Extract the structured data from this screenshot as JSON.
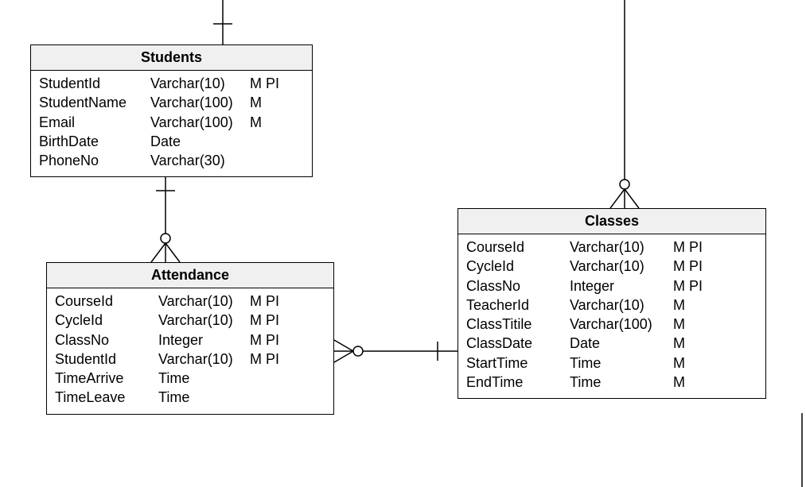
{
  "entities": {
    "students": {
      "title": "Students",
      "attrs": [
        {
          "name": "StudentId",
          "type": "Varchar(10)",
          "flags": "M PI"
        },
        {
          "name": "StudentName",
          "type": "Varchar(100)",
          "flags": "M"
        },
        {
          "name": "Email",
          "type": "Varchar(100)",
          "flags": "M"
        },
        {
          "name": "BirthDate",
          "type": "Date",
          "flags": ""
        },
        {
          "name": "PhoneNo",
          "type": "Varchar(30)",
          "flags": ""
        }
      ]
    },
    "attendance": {
      "title": "Attendance",
      "attrs": [
        {
          "name": "CourseId",
          "type": "Varchar(10)",
          "flags": "M PI"
        },
        {
          "name": "CycleId",
          "type": "Varchar(10)",
          "flags": "M PI"
        },
        {
          "name": "ClassNo",
          "type": "Integer",
          "flags": "M PI"
        },
        {
          "name": "StudentId",
          "type": "Varchar(10)",
          "flags": "M PI"
        },
        {
          "name": "TimeArrive",
          "type": "Time",
          "flags": ""
        },
        {
          "name": "TimeLeave",
          "type": "Time",
          "flags": ""
        }
      ]
    },
    "classes": {
      "title": "Classes",
      "attrs": [
        {
          "name": "CourseId",
          "type": "Varchar(10)",
          "flags": "M PI"
        },
        {
          "name": "CycleId",
          "type": "Varchar(10)",
          "flags": "M PI"
        },
        {
          "name": "ClassNo",
          "type": "Integer",
          "flags": "M PI"
        },
        {
          "name": "TeacherId",
          "type": "Varchar(10)",
          "flags": "M"
        },
        {
          "name": "ClassTitile",
          "type": "Varchar(100)",
          "flags": "M"
        },
        {
          "name": "ClassDate",
          "type": "Date",
          "flags": "M"
        },
        {
          "name": "StartTime",
          "type": "Time",
          "flags": "M"
        },
        {
          "name": "EndTime",
          "type": "Time",
          "flags": "M"
        }
      ]
    }
  }
}
